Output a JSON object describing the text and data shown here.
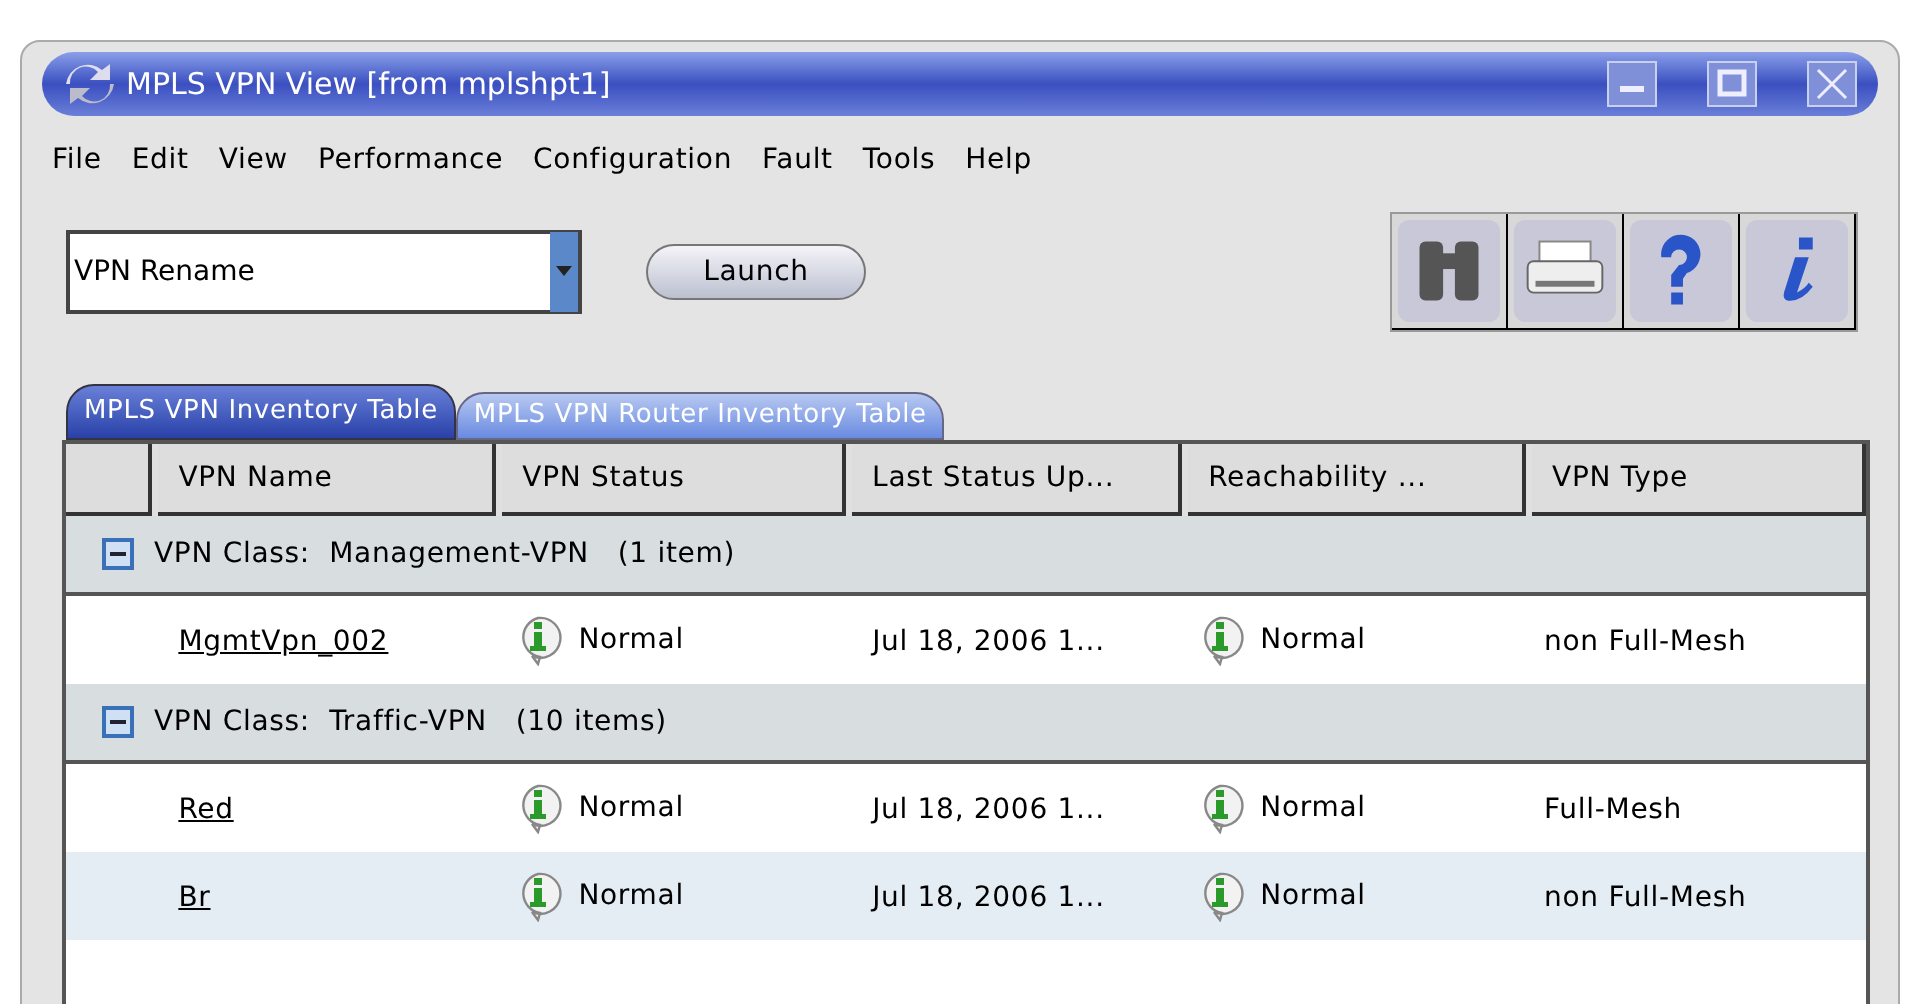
{
  "window": {
    "title": "MPLS VPN View [from mplshpt1]"
  },
  "menu": [
    "File",
    "Edit",
    "View",
    "Performance",
    "Configuration",
    "Fault",
    "Tools",
    "Help"
  ],
  "action": {
    "value": "VPN Rename",
    "button": "Launch"
  },
  "tabs": [
    {
      "label": "MPLS VPN Inventory Table",
      "selected": true
    },
    {
      "label": "MPLS VPN Router Inventory Table",
      "selected": false
    }
  ],
  "table": {
    "columns": [
      "VPN Name",
      "VPN Status",
      "Last Status Up...",
      "Reachability ...",
      "VPN Type"
    ],
    "groups": [
      {
        "label": "VPN Class:  Management-VPN   (1 item)",
        "expanded": true,
        "rows": [
          {
            "name": "MgmtVpn_002",
            "status": "Normal",
            "last_update": "Jul 18, 2006 1...",
            "reachability": "Normal",
            "type": "non Full-Mesh"
          }
        ]
      },
      {
        "label": "VPN Class:  Traffic-VPN   (10 items)",
        "expanded": true,
        "rows": [
          {
            "name": "Red",
            "status": "Normal",
            "last_update": "Jul 18, 2006 1...",
            "reachability": "Normal",
            "type": "Full-Mesh"
          },
          {
            "name": "Br",
            "status": "Normal",
            "last_update": "Jul 18, 2006 1...",
            "reachability": "Normal",
            "type": "non Full-Mesh"
          }
        ]
      }
    ]
  }
}
